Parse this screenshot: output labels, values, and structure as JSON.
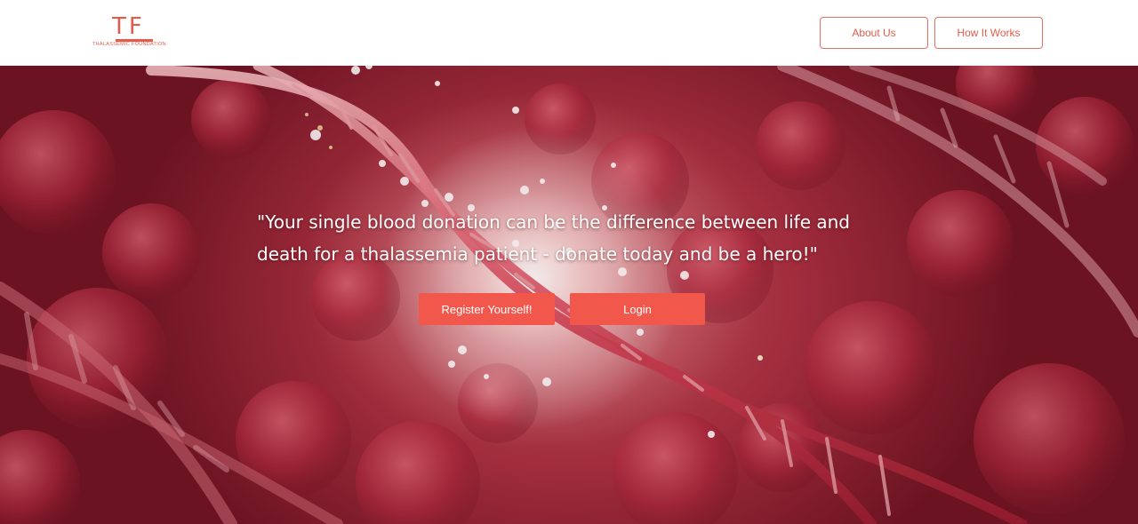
{
  "brand": {
    "mark": "TF",
    "name": "THALASSEMIC FOUNDATION"
  },
  "nav": {
    "about_label": "About Us",
    "how_label": "How It Works"
  },
  "hero": {
    "quote": "\"Your single blood donation can be the difference between life and death for a thalassemia patient - donate today and be a hero!\"",
    "register_label": "Register Yourself!",
    "login_label": "Login"
  },
  "colors": {
    "accent": "#f1574b",
    "brand": "#e35b4b",
    "hero_dark": "#6e1423"
  }
}
